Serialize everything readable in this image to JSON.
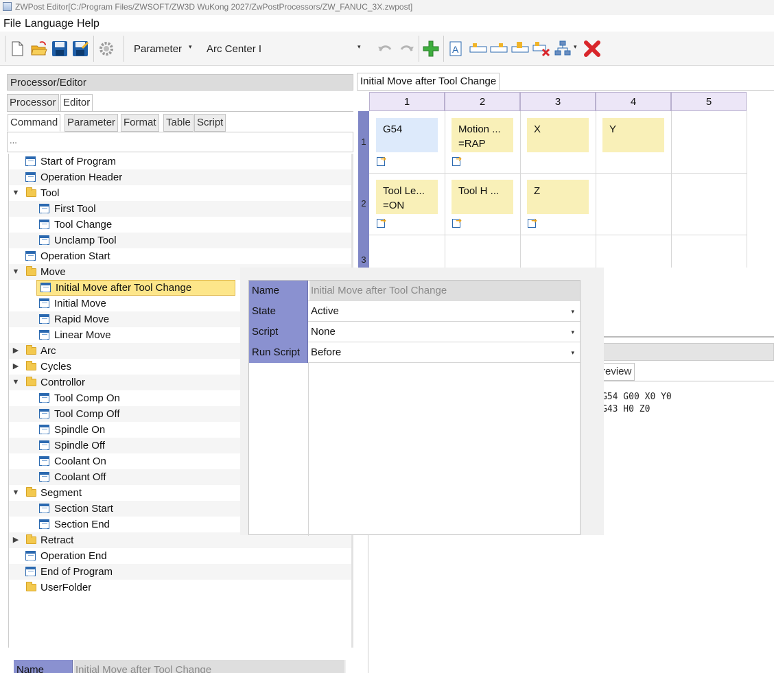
{
  "window": {
    "title": "ZWPost Editor[C:/Program Files/ZWSOFT/ZW3D WuKong 2027/ZwPostProcessors/ZW_FANUC_3X.zwpost]"
  },
  "menu": [
    "File",
    "Language",
    "Help"
  ],
  "toolbar": {
    "combo1": "Parameter",
    "combo2": "Arc Center I"
  },
  "left": {
    "header": "Processor/Editor",
    "top_tabs": [
      "Processor",
      "Editor"
    ],
    "sub_tabs": [
      "Command",
      "Parameter",
      "Format",
      "Table",
      "Script"
    ],
    "filter_text": "...",
    "tree": [
      {
        "label": "Start of Program"
      },
      {
        "label": "Operation Header"
      },
      {
        "label": "Tool"
      },
      {
        "label": "First Tool"
      },
      {
        "label": "Tool Change"
      },
      {
        "label": "Unclamp Tool"
      },
      {
        "label": "Operation Start"
      },
      {
        "label": "Move"
      },
      {
        "label": "Initial Move after Tool Change"
      },
      {
        "label": "Initial Move"
      },
      {
        "label": "Rapid Move"
      },
      {
        "label": "Linear Move"
      },
      {
        "label": "Arc"
      },
      {
        "label": "Cycles"
      },
      {
        "label": "Controllor"
      },
      {
        "label": "Tool Comp On"
      },
      {
        "label": "Tool Comp Off"
      },
      {
        "label": "Spindle On"
      },
      {
        "label": "Spindle Off"
      },
      {
        "label": "Coolant On"
      },
      {
        "label": "Coolant Off"
      },
      {
        "label": "Segment"
      },
      {
        "label": "Section Start"
      },
      {
        "label": "Section End"
      },
      {
        "label": "Retract"
      },
      {
        "label": "Operation End"
      },
      {
        "label": "End of Program"
      },
      {
        "label": "UserFolder"
      }
    ],
    "bottom_strip": {
      "key": "Name",
      "value": "Initial Move after Tool Change"
    }
  },
  "grid": {
    "tab_label": "Initial Move after Tool Change",
    "columns": [
      "1",
      "2",
      "3",
      "4",
      "5"
    ],
    "rows": [
      "1",
      "2",
      "3"
    ],
    "cells": [
      {
        "line1": "G54",
        "line2": ""
      },
      {
        "line1": "Motion ...",
        "line2": "=RAP"
      },
      {
        "line1": "X",
        "line2": ""
      },
      {
        "line1": "Y",
        "line2": ""
      },
      {
        "line1": "Tool Le...",
        "line2": "=ON"
      },
      {
        "line1": "Tool H ...",
        "line2": ""
      },
      {
        "line1": "Z",
        "line2": ""
      }
    ]
  },
  "properties": {
    "name_label": "Name",
    "name_value": "Initial Move after Tool Change",
    "state_label": "State",
    "state_value": "Active",
    "script_label": "Script",
    "script_value": "None",
    "runscript_label": "Run Script",
    "runscript_value": "Before"
  },
  "preview": {
    "tab_label": "Preview",
    "lines": [
      "G54 G00 X0 Y0",
      "G43 H0 Z0"
    ]
  }
}
